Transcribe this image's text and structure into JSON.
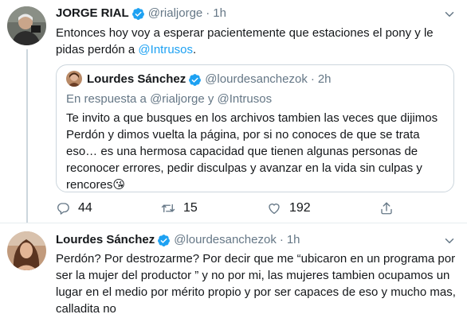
{
  "tweet1": {
    "name": "JORGE RIAL",
    "handle": "@rialjorge",
    "dot": "·",
    "time": "1h",
    "text_before": "Entonces hoy voy a esperar pacientemente que estaciones el pony y le pidas perdón a ",
    "mention": "@Intrusos",
    "text_after": ".",
    "quote": {
      "name": "Lourdes Sánchez",
      "handle": "@lourdesanchezok",
      "dot": "·",
      "time": "2h",
      "reply_prefix": "En respuesta a ",
      "reply_user1": "@rialjorge",
      "reply_join": " y ",
      "reply_user2": "@Intrusos",
      "text": "Te invito a que busques en los archivos tambien las veces que dijimos Perdón y dimos vuelta la página, por si no conoces de que se trata eso… es una hermosa capacidad que tienen algunas personas de reconocer errores, pedir disculpas y avanzar en la vida sin culpas y rencores😘"
    },
    "actions": {
      "replies": "44",
      "retweets": "15",
      "likes": "192"
    }
  },
  "tweet2": {
    "name": "Lourdes Sánchez",
    "handle": "@lourdesanchezok",
    "dot": "·",
    "time": "1h",
    "text": "Perdón? Por destrozarme? Por decir que me “ubicaron en un programa por ser la mujer del productor ” y no por mi, las mujeres tambien ocupamos un lugar en el medio por mérito propio y por ser capaces de eso y mucho mas, calladita no"
  },
  "icons": {
    "verified": "verified-badge-icon",
    "chevron": "chevron-down-icon",
    "reply": "reply-icon",
    "retweet": "retweet-icon",
    "like": "heart-icon",
    "share": "share-icon"
  },
  "colors": {
    "link": "#1da1f2",
    "secondary": "#657786",
    "border": "#ccd6dd"
  }
}
